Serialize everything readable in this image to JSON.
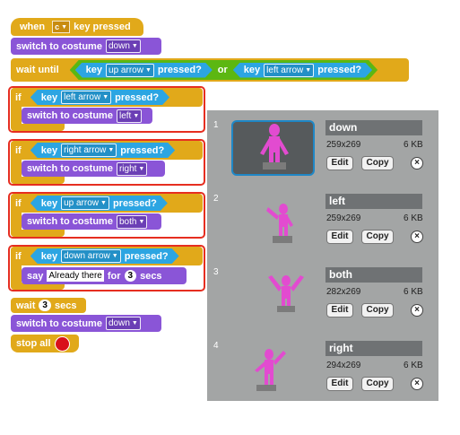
{
  "script": {
    "hat": {
      "prefix": "when",
      "key": "c",
      "suffix": "key pressed"
    },
    "switch1": {
      "label": "switch to costume",
      "value": "down"
    },
    "wait_until": {
      "label": "wait until",
      "or": "or",
      "s1": {
        "key": "key",
        "option": "up arrow",
        "suffix": "pressed?"
      },
      "s2": {
        "key": "key",
        "option": "left arrow",
        "suffix": "pressed?"
      }
    },
    "ifs": [
      {
        "if": "if",
        "key": "key",
        "option": "left arrow",
        "suffix": "pressed?",
        "inner_label": "switch to costume",
        "inner_value": "left"
      },
      {
        "if": "if",
        "key": "key",
        "option": "right arrow",
        "suffix": "pressed?",
        "inner_label": "switch to costume",
        "inner_value": "right"
      },
      {
        "if": "if",
        "key": "key",
        "option": "up arrow",
        "suffix": "pressed?",
        "inner_label": "switch to costume",
        "inner_value": "both"
      },
      {
        "if": "if",
        "key": "key",
        "option": "down arrow",
        "suffix": "pressed?"
      }
    ],
    "say": {
      "say": "say",
      "text": "Already there",
      "for": "for",
      "secs_value": "3",
      "secs": "secs"
    },
    "wait": {
      "label": "wait",
      "value": "3",
      "secs": "secs"
    },
    "switch_final": {
      "label": "switch to costume",
      "value": "down"
    },
    "stop": {
      "label": "stop all"
    }
  },
  "costumes": [
    {
      "index": "1",
      "name": "down",
      "size": "259x269",
      "kb": "6 KB",
      "edit": "Edit",
      "copy": "Copy",
      "delete": "×"
    },
    {
      "index": "2",
      "name": "left",
      "size": "259x269",
      "kb": "6 KB",
      "edit": "Edit",
      "copy": "Copy",
      "delete": "×"
    },
    {
      "index": "3",
      "name": "both",
      "size": "282x269",
      "kb": "6 KB",
      "edit": "Edit",
      "copy": "Copy",
      "delete": "×"
    },
    {
      "index": "4",
      "name": "right",
      "size": "294x269",
      "kb": "6 KB",
      "edit": "Edit",
      "copy": "Copy",
      "delete": "×"
    }
  ],
  "icons": {
    "dropdown": "chevron-down-icon",
    "stop": "stop-sign-icon",
    "delete": "close-icon"
  },
  "colors": {
    "control": "#e1a91a",
    "looks": "#8a55d7",
    "sensing": "#2ca5e2",
    "selection": "#e62e20",
    "panel": "#a3a5a5",
    "sprite": "#e24bd0"
  }
}
